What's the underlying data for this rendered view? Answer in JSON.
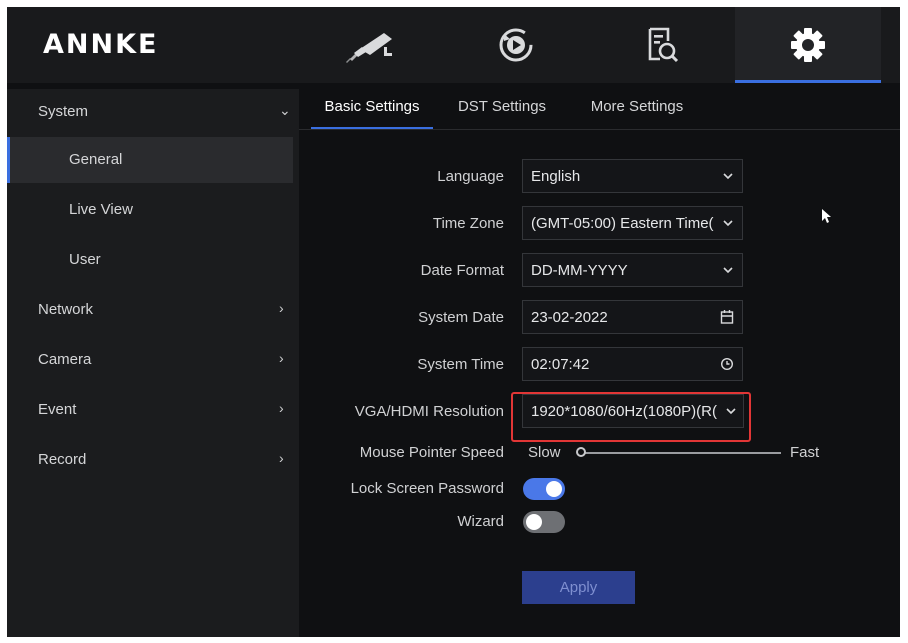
{
  "app": {
    "logo_text": "ANNKE"
  },
  "top_nav": [
    {
      "icon": "camera-icon",
      "active": false
    },
    {
      "icon": "playback-icon",
      "active": false
    },
    {
      "icon": "search-file-icon",
      "active": false
    },
    {
      "icon": "gear-icon",
      "active": true
    }
  ],
  "sidebar": {
    "system": {
      "label": "System",
      "expanded": true
    },
    "sub_items": [
      {
        "label": "General",
        "active": true
      },
      {
        "label": "Live View",
        "active": false
      },
      {
        "label": "User",
        "active": false
      }
    ],
    "items": [
      {
        "label": "Network"
      },
      {
        "label": "Camera"
      },
      {
        "label": "Event"
      },
      {
        "label": "Record"
      }
    ]
  },
  "tabs": [
    {
      "label": "Basic Settings",
      "active": true
    },
    {
      "label": "DST Settings",
      "active": false
    },
    {
      "label": "More Settings",
      "active": false
    }
  ],
  "form": {
    "language": {
      "label": "Language",
      "value": "English"
    },
    "time_zone": {
      "label": "Time Zone",
      "value": "(GMT-05:00) Eastern Time("
    },
    "date_format": {
      "label": "Date Format",
      "value": "DD-MM-YYYY"
    },
    "system_date": {
      "label": "System Date",
      "value": "23-02-2022"
    },
    "system_time": {
      "label": "System Time",
      "value": "02:07:42"
    },
    "resolution": {
      "label": "VGA/HDMI Resolution",
      "value": "1920*1080/60Hz(1080P)(R("
    },
    "mouse_speed": {
      "label": "Mouse Pointer Speed",
      "min_label": "Slow",
      "max_label": "Fast",
      "level": 0
    },
    "lock_screen": {
      "label": "Lock Screen Password",
      "on": true
    },
    "wizard": {
      "label": "Wizard",
      "on": false
    },
    "apply_label": "Apply"
  },
  "colors": {
    "accent": "#3a6fe0",
    "highlight": "#e23636",
    "toggle_on": "#4a78e8",
    "toggle_off": "#6e7074",
    "apply_bg": "#2c3f8e"
  }
}
